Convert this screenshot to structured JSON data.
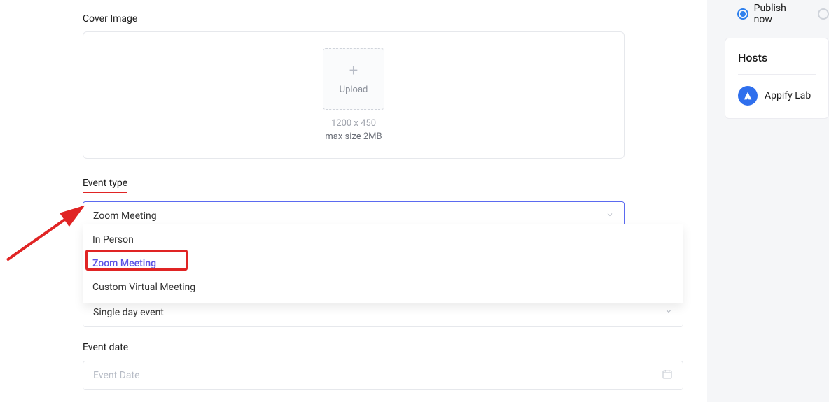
{
  "coverImage": {
    "label": "Cover Image",
    "uploadLabel": "Upload",
    "dimensions": "1200 x 450",
    "maxSize": "max size 2MB"
  },
  "eventType": {
    "label": "Event type",
    "selected": "Zoom Meeting",
    "options": {
      "in_person": "In Person",
      "zoom": "Zoom Meeting",
      "custom_virtual": "Custom Virtual Meeting"
    }
  },
  "eventDuration": {
    "selected": "Single day event"
  },
  "eventDate": {
    "label": "Event date",
    "placeholder": "Event Date"
  },
  "publish": {
    "now": "Publish now"
  },
  "hosts": {
    "title": "Hosts",
    "items": [
      {
        "name": "Appify Lab"
      }
    ]
  }
}
